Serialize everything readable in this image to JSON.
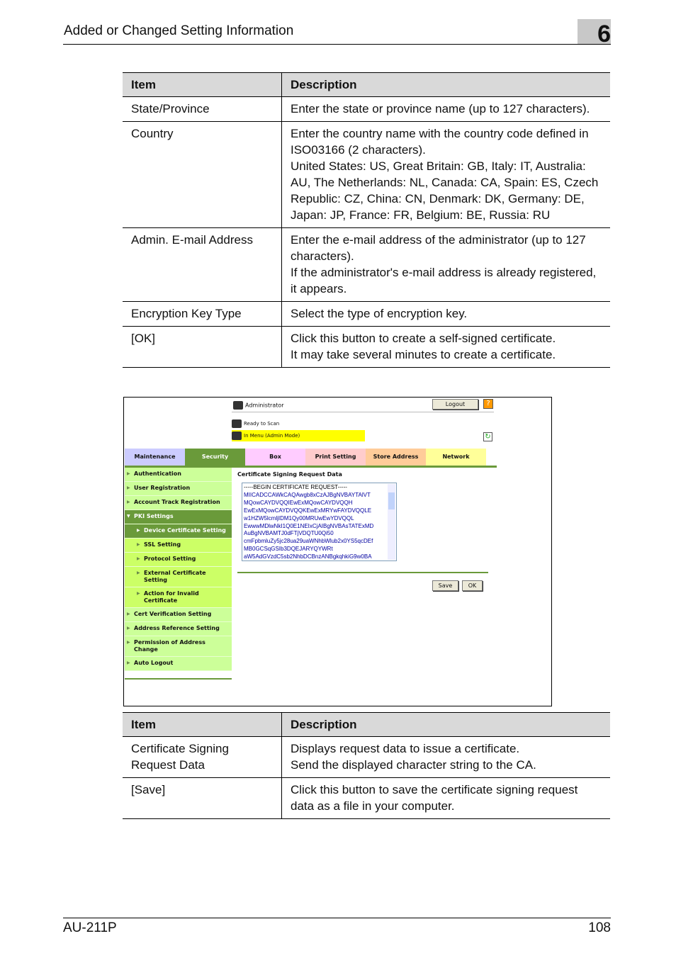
{
  "header": {
    "title": "Added or Changed Setting Information",
    "chapter": "6"
  },
  "table1": {
    "headers": [
      "Item",
      "Description"
    ],
    "rows": [
      [
        "State/Province",
        [
          "Enter the state or province name (up to 127 characters)."
        ]
      ],
      [
        "Country",
        [
          "Enter the country name with the country code defined in ISO03166 (2 characters).",
          "United States: US, Great Britain: GB, Italy: IT, Australia: AU, The Netherlands: NL, Canada: CA, Spain: ES, Czech Republic: CZ, China: CN, Denmark: DK, Germany: DE, Japan: JP, France: FR, Belgium: BE, Russia: RU"
        ]
      ],
      [
        "Admin. E-mail Address",
        [
          "Enter the e-mail address of the administrator (up to 127 characters).",
          "If the administrator's e-mail address is already registered, it appears."
        ]
      ],
      [
        "Encryption Key Type",
        [
          "Select the type of encryption key."
        ]
      ],
      [
        "[OK]",
        [
          "Click this button to create a self-signed certificate.",
          "It may take several minutes to create a certificate."
        ]
      ]
    ]
  },
  "screenshot": {
    "user": "Administrator",
    "logout": "Logout",
    "help": "?",
    "status1": "Ready to Scan",
    "status2": "In Menu (Admin Mode)",
    "tabs": [
      {
        "label": "Maintenance",
        "color": "#ccccff"
      },
      {
        "label": "Security",
        "color": "#6a9a3a"
      },
      {
        "label": "Box",
        "color": "#ffccff"
      },
      {
        "label": "Print Setting",
        "color": "#ffcccc"
      },
      {
        "label": "Store Address",
        "color": "#ffcc99"
      },
      {
        "label": "Network",
        "color": "#ffff99"
      }
    ],
    "sidebar": [
      "Authentication",
      "User Registration",
      "Account Track Registration",
      "PKI Settings",
      "Device Certificate Setting",
      "SSL Setting",
      "Protocol Setting",
      "External Certificate Setting",
      "Action for Invalid Certificate",
      "Cert Verification Setting",
      "Address Reference Setting",
      "Permission of Address Change",
      "Auto Logout"
    ],
    "content_title": "Certificate Signing Request Data",
    "csr_lines": [
      "-----BEGIN CERTIFICATE REQUEST-----",
      "MIICADCCAWkCAQAwgb8xCzAJBgNVBAYTAlVT",
      "MQowCAYDVQQIEwExMQowCAYDVQQH",
      "EwExMQowCAYDVQQKEwExMRYwFAYDVQQLE",
      "w1HZW5lcmljIDM1Qy00MRUwEwYDVQQL",
      "EwwwMDlwNkI1Q0E1NEIxCjAIBgNVBAsTATExMD",
      "AuBgNVBAMTJ0dFTjVDQTU0Qi50",
      "cmFpbmluZy5jc28ua29uaWNhbWlub2x0YS5qcDEf",
      "MB0GCSqGSIb3DQEJARYQYWRt",
      "aW5AdGVzdC5sb2NhbDCBnzANBgkqhkiG9w0BA"
    ],
    "save": "Save",
    "ok": "OK"
  },
  "table2": {
    "headers": [
      "Item",
      "Description"
    ],
    "rows": [
      [
        "Certificate Signing Request Data",
        [
          "Displays request data to issue a certificate.",
          "Send the displayed character string to the CA."
        ]
      ],
      [
        "[Save]",
        [
          "Click this button to save the certificate signing request data as a file in your computer."
        ]
      ]
    ]
  },
  "footer": {
    "left": "AU-211P",
    "right": "108"
  }
}
